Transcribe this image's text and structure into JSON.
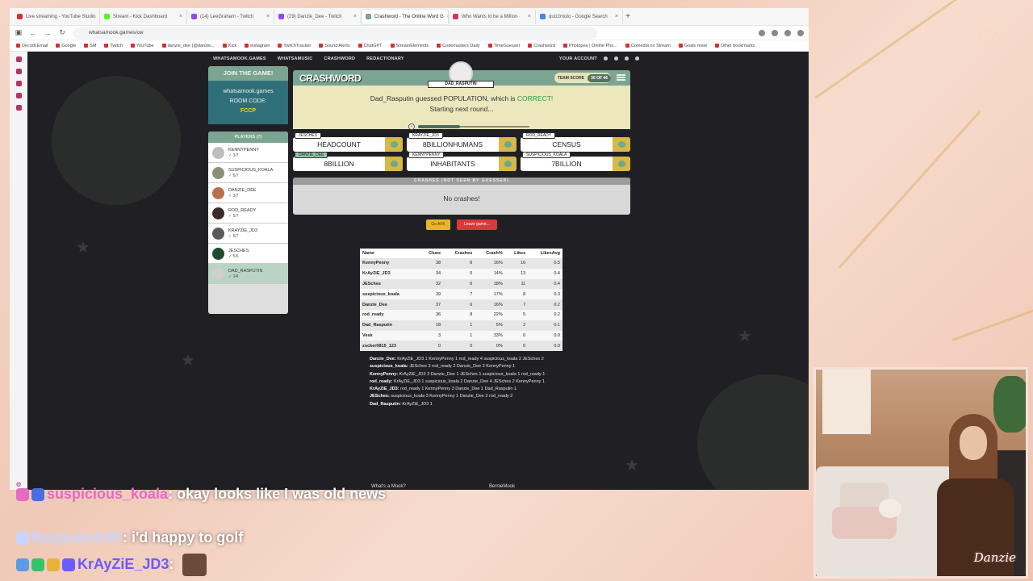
{
  "browser": {
    "tabs": [
      {
        "label": "Live streaming - YouTube Studio",
        "color": "#e02b2b",
        "active": false
      },
      {
        "label": "Stream - Kick Dashboard",
        "color": "#53fc18",
        "active": false
      },
      {
        "label": "(14) LeeGraham - Twitch",
        "color": "#9146ff",
        "active": false
      },
      {
        "label": "(29) Danzie_Dee - Twitch",
        "color": "#9146ff",
        "active": false
      },
      {
        "label": "Crashword - The Online Word G",
        "color": "#7aa592",
        "active": true
      },
      {
        "label": "Who Wants to be a Million",
        "color": "#d6336c",
        "active": false
      },
      {
        "label": "quizzmoto - Google Search",
        "color": "#4285f4",
        "active": false
      }
    ],
    "url": "whatsamook.games/cw",
    "bookmarks": [
      "Decodi Email",
      "Google",
      "SM",
      "Twitch",
      "YouTube",
      "danzie_dee (@danzie...",
      "Kick",
      "instagram",
      "TwitchTracker",
      "Sound Alerts",
      "ChatGPT",
      "StreamElements",
      "Codemasters Daily",
      "TimeGuesser",
      "Crashword",
      "Photopea | Online Pho...",
      "Comedia on Stream",
      "Goals reset",
      "Other bookmarks"
    ]
  },
  "nav": {
    "links": [
      "WHATSAMOOK.GAMES",
      "WHATSAMUSIC",
      "CRASHWORD",
      "REDACTIONARY"
    ],
    "account": "YOUR ACCOUNT"
  },
  "room": {
    "join_label": "JOIN THE GAME!",
    "site": "whatsamook.games",
    "code_label": "ROOM CODE:",
    "code": "FCCP"
  },
  "players": {
    "header": "PLAYERS (7)",
    "list": [
      {
        "name": "KENNYPENNY",
        "score": "✓ 3/7",
        "color": "#bdbdbd"
      },
      {
        "name": "SUSPICIOUS_KOALA",
        "score": "✓ 6/7",
        "color": "#8b8f7a"
      },
      {
        "name": "DANZIE_DEE",
        "score": "✓ 3/7",
        "color": "#b8704a"
      },
      {
        "name": "ROD_READY",
        "score": "✓ 5/7",
        "color": "#3c2b2b"
      },
      {
        "name": "KRAYZIE_JD3",
        "score": "✓ 5/7",
        "color": "#5a5a5a"
      },
      {
        "name": "JESCHES",
        "score": "✓ 5/6",
        "color": "#1d4d2c"
      },
      {
        "name": "DAD_RASPUTIN",
        "score": "✓ 3/4",
        "color": "#cfcfcf"
      }
    ]
  },
  "game": {
    "logo": "CRASHWORD",
    "team_score_label": "TEAM SCORE",
    "team_score_value": "30 OF 46",
    "guesser": "DAD_RASPUTIN",
    "message_line1_pre": "Dad_Rasputin guessed POPULATION, which is ",
    "message_correct": "CORRECT!",
    "message_line2": "Starting next round...",
    "timer_progress": 0.38
  },
  "clues": [
    {
      "author": "JESCHES",
      "word": "HEADCOUNT",
      "green": false
    },
    {
      "author": "KRAYZIE_JD3",
      "word": "8BILLIONHUMANS",
      "green": false
    },
    {
      "author": "ROD_READY",
      "word": "CENSUS",
      "green": false
    },
    {
      "author": "DANZIE_DEE",
      "word": "8BILLION",
      "green": true
    },
    {
      "author": "KENNYPENNY",
      "word": "INHABITANTS",
      "green": false
    },
    {
      "author": "SUSPICIOUS_KOALA",
      "word": "7BILLION",
      "green": false
    }
  ],
  "crashes": {
    "header": "CRASHES (NOT SEEN BY GUESSER)",
    "body": "No crashes!"
  },
  "buttons": {
    "afk": "Go AFK",
    "leave": "Leave game..."
  },
  "stats": {
    "headers": [
      "Name",
      "Clues",
      "Crashes",
      "Crash%",
      "Likes",
      "LikesAvg"
    ],
    "rows": [
      [
        "KennyPenny",
        "38",
        "6",
        "16%",
        "16",
        "0.5"
      ],
      [
        "KrAyZiE_JD3",
        "34",
        "5",
        "14%",
        "13",
        "0.4"
      ],
      [
        "JESches",
        "32",
        "6",
        "18%",
        "11",
        "0.4"
      ],
      [
        "suspicious_koala",
        "39",
        "7",
        "17%",
        "8",
        "0.3"
      ],
      [
        "Danzie_Dee",
        "37",
        "6",
        "16%",
        "7",
        "0.2"
      ],
      [
        "rod_ready",
        "36",
        "8",
        "22%",
        "5",
        "0.2"
      ],
      [
        "Dad_Rasputin",
        "18",
        "1",
        "5%",
        "2",
        "0.1"
      ],
      [
        "Vesk",
        "3",
        "1",
        "33%",
        "0",
        "0.0"
      ],
      [
        "zocker0815_123",
        "0",
        "0",
        "0%",
        "0",
        "0.0"
      ]
    ]
  },
  "likes_summary": [
    {
      "name": "Danzie_Dee:",
      "text": " KrAyZiE_JD3 1 KennyPenny 1 rod_ready 4 suspicious_koala 2 JESches 2"
    },
    {
      "name": "suspicious_koala:",
      "text": " JESches 3 rod_ready 2 Danzie_Dee 2 KennyPenny 1"
    },
    {
      "name": "KennyPenny:",
      "text": " KrAyZiE_JD3 3 Danzie_Dee 1 JESches 1 suspicious_koala 1 rod_ready 1"
    },
    {
      "name": "rod_ready:",
      "text": " KrAyZiE_JD3 1 suspicious_koala 2 Danzie_Dee 4 JESches 2 KennyPenny 1"
    },
    {
      "name": "KrAyZiE_JD3:",
      "text": " rod_ready 1 KennyPenny 3 Danzie_Dee 1 Dad_Rasputin 1"
    },
    {
      "name": "JESches:",
      "text": " suspicious_koala 3 KennyPenny 1 Danzie_Dee 2 rod_ready 2"
    },
    {
      "name": "Dad_Rasputin:",
      "text": " KrAyZiE_JD3 1"
    }
  ],
  "footer": {
    "left": "What's a Mook?",
    "right": "BernieMook"
  },
  "chat": [
    {
      "user": "suspicious_koala",
      "text": ": okay looks like I was old news"
    },
    {
      "user": "RasputinASF",
      "text": ": i'd happy to golf"
    },
    {
      "user": "KrAyZiE_JD3",
      "text": ":"
    }
  ],
  "webcam": {
    "logo": "Danzie"
  }
}
